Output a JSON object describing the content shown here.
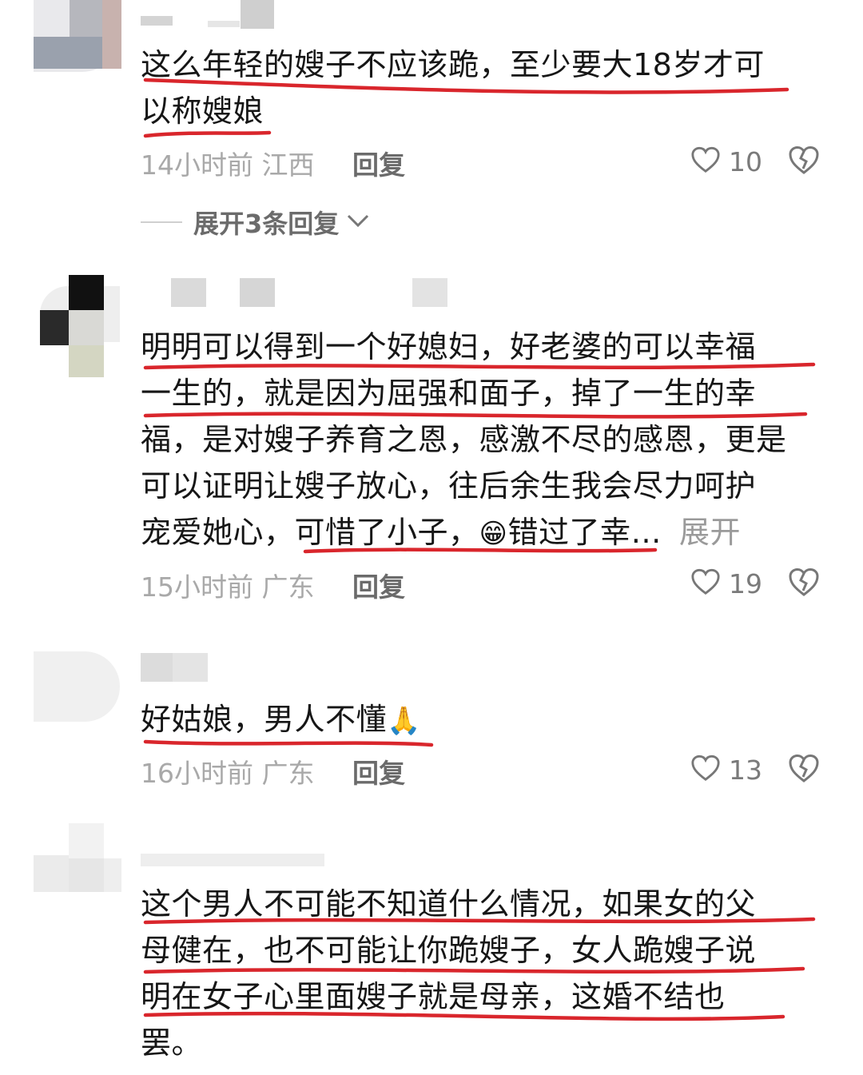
{
  "comments": [
    {
      "lines": [
        "这么年轻的嫂子不应该跪，至少要大18岁才可",
        "以称嫂娘"
      ],
      "time_location": "14小时前 江西",
      "reply_label": "回复",
      "likes": "10",
      "expand_label": "展开3条回复"
    },
    {
      "lines": [
        "明明可以得到一个好媳妇，好老婆的可以幸福",
        "一生的，就是因为屈强和面子，掉了一生的幸",
        "福，是对嫂子养育之恩，感激不尽的感恩，更是",
        "可以证明让嫂子放心，往后余生我会尽力呵护",
        "宠爱她心，可惜了小子，"
      ],
      "last_line_tail": "错过了幸…",
      "more_label": "展开",
      "time_location": "15小时前 广东",
      "reply_label": "回复",
      "likes": "19"
    },
    {
      "lines": [
        "好姑娘，男人不懂"
      ],
      "time_location": "16小时前 广东",
      "reply_label": "回复",
      "likes": "13"
    },
    {
      "lines": [
        "这个男人不可能不知道什么情况，如果女的父",
        "母健在，也不可能让你跪嫂子，女人跪嫂子说",
        "明在女子心里面嫂子就是母亲，这婚不结也",
        "罢。"
      ]
    }
  ],
  "icons": {
    "like": "heart-outline-icon",
    "dislike": "broken-heart-icon",
    "expand": "chevron-down-icon",
    "grin": "grinning-face-emoji",
    "pray": "folded-hands-emoji"
  },
  "colors": {
    "annotation": "#d9262c",
    "meta_text": "#a9a9a9",
    "reply_text": "#6b6b6b"
  }
}
